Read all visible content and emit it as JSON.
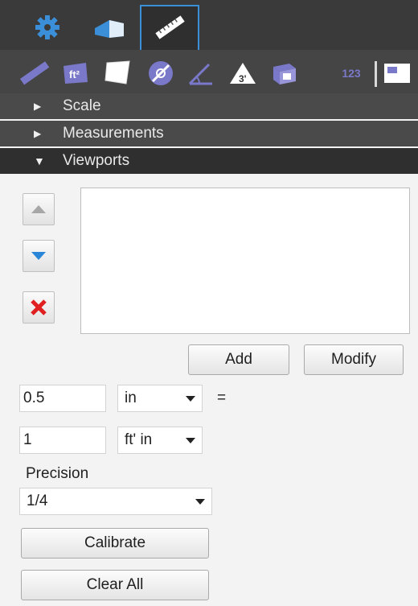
{
  "tabs": [
    {
      "icon": "gear-icon",
      "active": false
    },
    {
      "icon": "building-icon",
      "active": false
    },
    {
      "icon": "ruler-icon",
      "active": true
    }
  ],
  "toolbar": {
    "tools": [
      "ruler-tool-icon",
      "area-ft2-icon",
      "polygon-icon",
      "circle-measure-icon",
      "angle-icon",
      "volume-3d-icon",
      "cube-icon",
      "count-icon",
      "viewport-icon"
    ],
    "count_label": "123"
  },
  "sections": {
    "scale": "Scale",
    "measurements": "Measurements",
    "viewports": "Viewports"
  },
  "buttons": {
    "add": "Add",
    "modify": "Modify",
    "calibrate": "Calibrate",
    "clear_all": "Clear All"
  },
  "scale": {
    "value1": "0.5",
    "unit1": "in",
    "equals": "=",
    "value2": "1",
    "unit2": "ft' in"
  },
  "precision": {
    "label": "Precision",
    "value": "1/4"
  },
  "colors": {
    "accent": "#3b8fd8",
    "delete_red": "#e02020",
    "tool_purple": "#7a78c8"
  }
}
